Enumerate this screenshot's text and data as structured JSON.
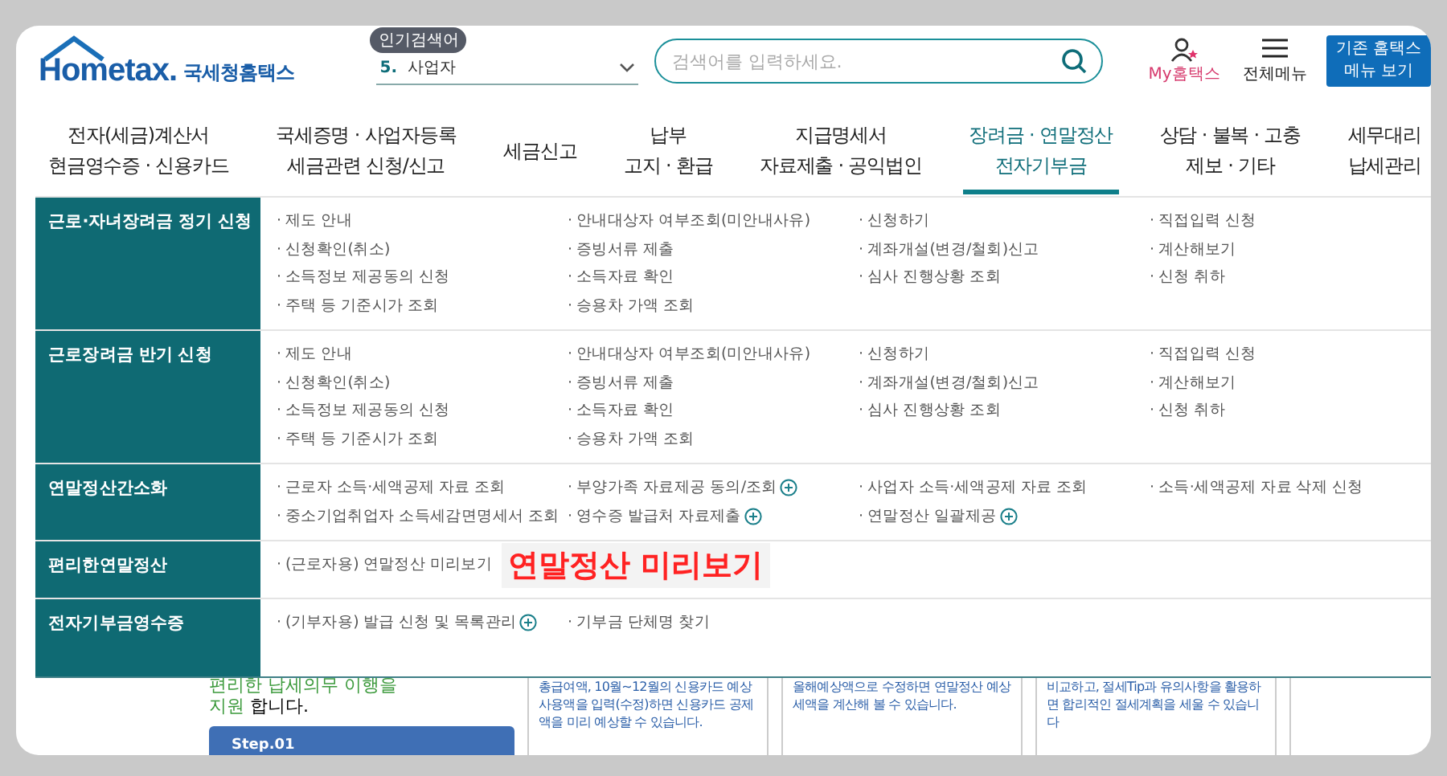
{
  "header": {
    "logo": {
      "brand": "Hometax.",
      "name": "국세청홈택스"
    },
    "popular": {
      "badge": "인기검색어",
      "rank": "5.",
      "term": "사업자"
    },
    "search": {
      "placeholder": "검색어를 입력하세요."
    },
    "my_link": "My홈택스",
    "all_menu": "전체메뉴",
    "legacy_button": [
      "기존 홈택스",
      "메뉴 보기"
    ]
  },
  "nav": [
    {
      "lines": [
        "전자(세금)계산서",
        "현금영수증 · 신용카드"
      ],
      "selected": false
    },
    {
      "lines": [
        "국세증명 · 사업자등록",
        "세금관련 신청/신고"
      ],
      "selected": false
    },
    {
      "lines": [
        "세금신고"
      ],
      "selected": false
    },
    {
      "lines": [
        "납부",
        "고지 · 환급"
      ],
      "selected": false
    },
    {
      "lines": [
        "지급명세서",
        "자료제출 · 공익법인"
      ],
      "selected": false
    },
    {
      "lines": [
        "장려금 · 연말정산",
        "전자기부금"
      ],
      "selected": true
    },
    {
      "lines": [
        "상담 · 불복 · 고충",
        "제보 · 기타"
      ],
      "selected": false
    },
    {
      "lines": [
        "세무대리",
        "납세관리"
      ],
      "selected": false
    }
  ],
  "mega_menu": [
    {
      "title": "근로·자녀장려금 정기 신청",
      "columns": [
        [
          {
            "text": "· 제도 안내",
            "plus": false
          },
          {
            "text": "· 신청확인(취소)",
            "plus": false
          },
          {
            "text": "· 소득정보 제공동의 신청",
            "plus": false
          },
          {
            "text": "· 주택 등 기준시가 조회",
            "plus": false
          }
        ],
        [
          {
            "text": "· 안내대상자 여부조회(미안내사유)",
            "plus": false
          },
          {
            "text": "· 증빙서류 제출",
            "plus": false
          },
          {
            "text": "· 소득자료 확인",
            "plus": false
          },
          {
            "text": "· 승용차 가액 조회",
            "plus": false
          }
        ],
        [
          {
            "text": "· 신청하기",
            "plus": false
          },
          {
            "text": "· 계좌개설(변경/철회)신고",
            "plus": false
          },
          {
            "text": "· 심사 진행상황 조회",
            "plus": false
          }
        ],
        [
          {
            "text": "· 직접입력 신청",
            "plus": false
          },
          {
            "text": "· 계산해보기",
            "plus": false
          },
          {
            "text": "· 신청 취하",
            "plus": false
          }
        ]
      ]
    },
    {
      "title": "근로장려금 반기 신청",
      "columns": [
        [
          {
            "text": "· 제도 안내",
            "plus": false
          },
          {
            "text": "· 신청확인(취소)",
            "plus": false
          },
          {
            "text": "· 소득정보 제공동의 신청",
            "plus": false
          },
          {
            "text": "· 주택 등 기준시가 조회",
            "plus": false
          }
        ],
        [
          {
            "text": "· 안내대상자 여부조회(미안내사유)",
            "plus": false
          },
          {
            "text": "· 증빙서류 제출",
            "plus": false
          },
          {
            "text": "· 소득자료 확인",
            "plus": false
          },
          {
            "text": "· 승용차 가액 조회",
            "plus": false
          }
        ],
        [
          {
            "text": "· 신청하기",
            "plus": false
          },
          {
            "text": "· 계좌개설(변경/철회)신고",
            "plus": false
          },
          {
            "text": "· 심사 진행상황 조회",
            "plus": false
          }
        ],
        [
          {
            "text": "· 직접입력 신청",
            "plus": false
          },
          {
            "text": "· 계산해보기",
            "plus": false
          },
          {
            "text": "· 신청 취하",
            "plus": false
          }
        ]
      ]
    },
    {
      "title": "연말정산간소화",
      "columns": [
        [
          {
            "text": "· 근로자 소득·세액공제 자료 조회",
            "plus": false
          },
          {
            "text": "· 중소기업취업자 소득세감면명세서 조회",
            "plus": false
          }
        ],
        [
          {
            "text": "· 부양가족 자료제공 동의/조회",
            "plus": true
          },
          {
            "text": "· 영수증 발급처 자료제출",
            "plus": true
          }
        ],
        [
          {
            "text": "· 사업자 소득·세액공제 자료 조회",
            "plus": false
          },
          {
            "text": "· 연말정산 일괄제공",
            "plus": true
          }
        ],
        [
          {
            "text": "· 소득·세액공제 자료 삭제 신청",
            "plus": false
          }
        ]
      ]
    },
    {
      "title": "편리한연말정산",
      "columns": [
        [
          {
            "text": "· (근로자용) 연말정산 미리보기",
            "plus": false
          }
        ]
      ],
      "callout": "연말정산 미리보기"
    },
    {
      "title": "전자기부금영수증",
      "columns": [
        [
          {
            "text": "· (기부자용) 발급 신청 및 목록관리",
            "plus": true
          }
        ],
        [
          {
            "text": "· 기부금 단체명 찾기",
            "plus": false
          }
        ]
      ]
    }
  ],
  "page": {
    "intro_line": "편리한 납세의무 이행을",
    "intro_highlight": "지원",
    "intro_rest": "합니다.",
    "step": "Step.01",
    "cards": [
      "총급여액, 10월~12월의 신용카드 예상 사용액을 입력(수정)하면 신용카드 공제액을 미리 예상할 수 있습니다.",
      "올해예상액으로 수정하면 연말정산 예상세액을 계산해 볼 수 있습니다.",
      "비교하고, 절세Tip과 유의사항을 활용하면 합리적인 절세계획을 세울 수 있습니다"
    ]
  }
}
